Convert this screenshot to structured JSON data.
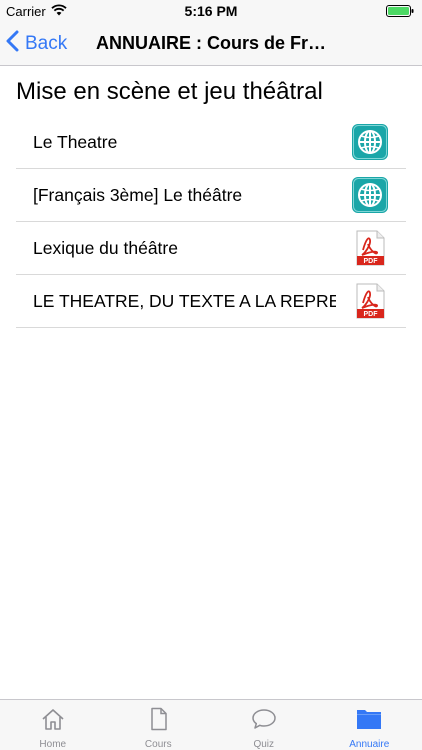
{
  "status_bar": {
    "carrier": "Carrier",
    "time": "5:16 PM",
    "icons": [
      "wifi-icon",
      "battery-icon"
    ]
  },
  "nav": {
    "back_label": "Back",
    "title": "ANNUAIRE : Cours de Fran..."
  },
  "section": {
    "title": "Mise en scène et jeu théâtral"
  },
  "items": [
    {
      "label": "Le Theatre",
      "icon": "globe-icon"
    },
    {
      "label": "[Français 3ème] Le théâtre",
      "icon": "globe-icon"
    },
    {
      "label": "Lexique du théâtre",
      "icon": "pdf-icon"
    },
    {
      "label": "LE THEATRE, DU TEXTE A LA REPRESE",
      "icon": "pdf-icon"
    }
  ],
  "pdf_badge": "PDF",
  "tabs": [
    {
      "label": "Home",
      "icon": "home-icon",
      "active": false
    },
    {
      "label": "Cours",
      "icon": "document-icon",
      "active": false
    },
    {
      "label": "Quiz",
      "icon": "chat-bubble-icon",
      "active": false
    },
    {
      "label": "Annuaire",
      "icon": "folder-icon",
      "active": true
    }
  ],
  "colors": {
    "accent": "#3478f6",
    "globe_teal": "#1aa6a8",
    "pdf_red": "#d9261c",
    "inactive_tab": "#8e8e93"
  }
}
